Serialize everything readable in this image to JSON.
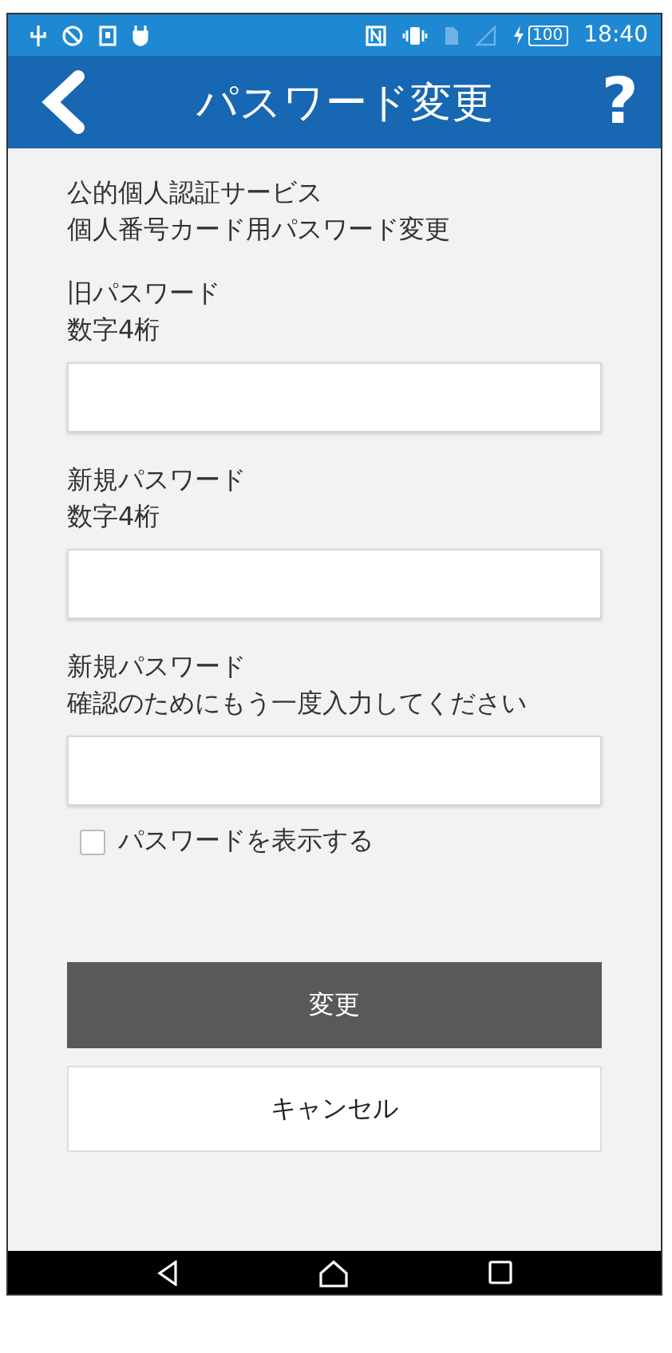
{
  "status_bar": {
    "battery": "100",
    "time": "18:40"
  },
  "app_bar": {
    "title": "パスワード変更",
    "help": "?"
  },
  "intro": [
    "公的個人認証サービス",
    "個人番号カード用パスワード変更"
  ],
  "fields": [
    {
      "label": "旧パスワード",
      "hint": "数字4桁"
    },
    {
      "label": "新規パスワード",
      "hint": "数字4桁"
    },
    {
      "label": "新規パスワード",
      "hint": "確認のためにもう一度入力してください"
    }
  ],
  "show_password": {
    "label": "パスワードを表示する",
    "checked": false
  },
  "buttons": [
    {
      "label": "変更",
      "kind": "primary"
    },
    {
      "label": "キャンセル",
      "kind": "secondary"
    }
  ]
}
